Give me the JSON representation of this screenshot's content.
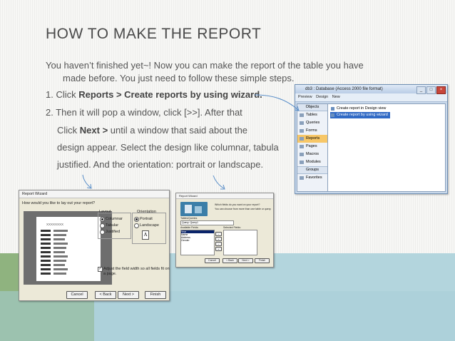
{
  "slide": {
    "title": "HOW TO MAKE THE REPORT",
    "intro_line1": "You haven’t finished yet~! Now you can make the report of the table you have",
    "intro_line2": "made before. You just need to follow these simple steps.",
    "step1_prefix": "1.   Click ",
    "step1_bold": "Reports > Create reports by using wizard.",
    "step2_line1": "2. Then it will pop a window, click [>>]. After that",
    "step2_line2_prefix": "Click ",
    "step2_line2_bold": "Next >",
    "step2_line2_suffix": " until a window that said about the",
    "step2_line3": "design appear. Select the design like columnar, tabula",
    "step2_line4": "justified. And the orientation: portrait or landscape."
  },
  "access_window": {
    "title": "db3 : Database (Access 2000 file format)",
    "toolbar": [
      "Preview",
      "Design",
      "New"
    ],
    "objects_header": "Objects",
    "objects": [
      "Tables",
      "Queries",
      "Forms",
      "Reports",
      "Pages",
      "Macros",
      "Modules"
    ],
    "selected_object": "Reports",
    "groups_header": "Groups",
    "groups": [
      "Favorites"
    ],
    "list_items": [
      "Create report in Design view",
      "Create report by using wizard"
    ],
    "selected_list_item": "Create report by using wizard"
  },
  "report_wizard": {
    "title": "Report Wizard",
    "question": "How would you like to lay out your report?",
    "layout_label": "Layout",
    "layout_options": [
      "Columnar",
      "Tabular",
      "Justified"
    ],
    "layout_selected": "Columnar",
    "orientation_label": "Orientation",
    "orientation_options": [
      "Portrait",
      "Landscape"
    ],
    "orientation_selected": "Portrait",
    "orientation_glyph": "A",
    "preview_header": "XXXXXXXX",
    "adjust_label_line1": "Adjust the field width so all fields fit on",
    "adjust_label_line2": "a page.",
    "adjust_checked": true,
    "buttons": [
      "Cancel",
      "< Back",
      "Next >",
      "Finish"
    ]
  },
  "report_wizard_small": {
    "title": "Report Wizard",
    "question_line1": "Which fields do you want on your report?",
    "question_line2": "You can choose from more than one table or query.",
    "tables_label": "Tables/Queries",
    "tables_value": "Query: Query1",
    "available_label": "Available Fields:",
    "selected_label": "Selected Fields:",
    "available_fields": [
      "Year",
      "Name",
      "Address",
      "Gender"
    ],
    "buttons": [
      "Cancel",
      "< Back",
      "Next >",
      "Finish"
    ]
  }
}
